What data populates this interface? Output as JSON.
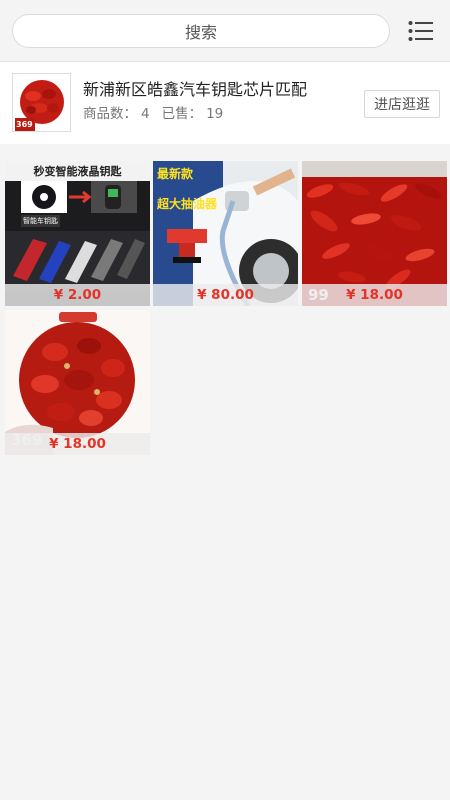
{
  "search": {
    "label": "搜索"
  },
  "header": {
    "menu_icon": "list-menu-icon"
  },
  "shop": {
    "name": "新浦新区皓鑫汽车钥匙芯片匹配",
    "product_count_label": "商品数：",
    "product_count": "4",
    "sold_label": "已售：",
    "sold": "19",
    "enter_label": "进店逛逛",
    "logo_badge": "369"
  },
  "products": [
    {
      "price": "¥ 2.00",
      "image_text": "秒变智能液晶钥匙",
      "image_tag": "智能车钥匙"
    },
    {
      "price": "¥ 80.00",
      "image_text": "最新款",
      "image_text2": "超大抽油器"
    },
    {
      "price": "¥ 18.00",
      "image_badge": "99"
    },
    {
      "price": "¥ 18.00",
      "image_badge": "369"
    }
  ],
  "colors": {
    "price": "#e6332a",
    "accent_red": "#c8101a"
  }
}
